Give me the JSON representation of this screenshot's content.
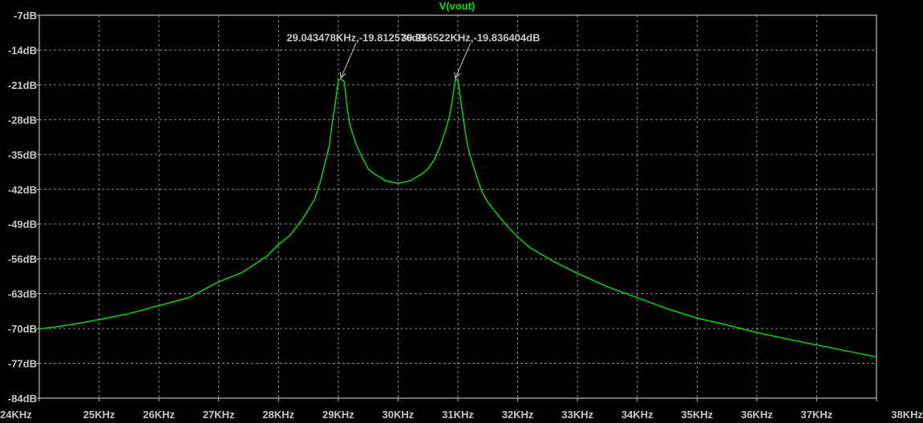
{
  "chart_data": {
    "type": "line",
    "title": "V(vout)",
    "x_unit": "KHz",
    "y_unit": "dB",
    "xlim": [
      24,
      38
    ],
    "ylim": [
      -84,
      -7
    ],
    "x_ticks": [
      24,
      25,
      26,
      27,
      28,
      29,
      30,
      31,
      32,
      33,
      34,
      35,
      36,
      37,
      38
    ],
    "x_tick_labels": [
      "24KHz",
      "25KHz",
      "26KHz",
      "27KHz",
      "28KHz",
      "29KHz",
      "30KHz",
      "31KHz",
      "32KHz",
      "33KHz",
      "34KHz",
      "35KHz",
      "36KHz",
      "37KHz",
      "38KHz"
    ],
    "y_ticks": [
      -7,
      -14,
      -21,
      -28,
      -35,
      -42,
      -49,
      -56,
      -63,
      -70,
      -77,
      -84
    ],
    "y_tick_labels": [
      "-7dB",
      "-14dB",
      "-21dB",
      "-28dB",
      "-35dB",
      "-42dB",
      "-49dB",
      "-56dB",
      "-63dB",
      "-70dB",
      "-77dB",
      "-84dB"
    ],
    "grid": true,
    "colors": {
      "background": "#000000",
      "trace": "#00e600",
      "grid": "#8c8c8c",
      "text": "#c8c8c8"
    },
    "series": [
      {
        "name": "V(vout)",
        "x": [
          24.0,
          24.5,
          25.0,
          25.5,
          26.0,
          26.5,
          27.0,
          27.4,
          27.8,
          28.0,
          28.2,
          28.4,
          28.5,
          28.6,
          28.7,
          28.8,
          28.85,
          28.9,
          28.95,
          29.0,
          29.04,
          29.1,
          29.15,
          29.2,
          29.3,
          29.4,
          29.5,
          29.6,
          29.8,
          30.0,
          30.2,
          30.4,
          30.5,
          30.6,
          30.7,
          30.8,
          30.85,
          30.9,
          30.96,
          31.0,
          31.05,
          31.1,
          31.15,
          31.2,
          31.3,
          31.4,
          31.5,
          31.6,
          31.8,
          32.0,
          32.2,
          32.6,
          33.0,
          33.5,
          34.0,
          34.5,
          35.0,
          35.5,
          36.0,
          36.5,
          37.0,
          37.5,
          38.0
        ],
        "y": [
          -70.1,
          -69.3,
          -68.2,
          -67.0,
          -65.4,
          -63.8,
          -60.6,
          -58.7,
          -55.5,
          -53.1,
          -51.2,
          -48.0,
          -46.1,
          -44.1,
          -40.5,
          -35.7,
          -33.2,
          -28.6,
          -24.8,
          -20.0,
          -19.81,
          -20.3,
          -25.8,
          -29.3,
          -33.0,
          -35.6,
          -37.9,
          -38.9,
          -40.3,
          -40.8,
          -40.3,
          -38.9,
          -37.9,
          -36.2,
          -33.5,
          -29.9,
          -27.7,
          -24.8,
          -19.84,
          -20.1,
          -24.3,
          -28.6,
          -32.4,
          -35.0,
          -38.9,
          -42.4,
          -44.6,
          -46.1,
          -49.1,
          -51.6,
          -53.7,
          -56.5,
          -58.9,
          -61.6,
          -63.8,
          -66.0,
          -67.9,
          -69.3,
          -70.8,
          -72.1,
          -73.3,
          -74.5,
          -75.7
        ]
      }
    ],
    "cursors": [
      {
        "x": 29.043478,
        "y": -19.812576,
        "label": "29.043478KHz,-19.812576dB"
      },
      {
        "x": 30.956522,
        "y": -19.836404,
        "label": "30.956522KHz,-19.836404dB"
      }
    ]
  }
}
